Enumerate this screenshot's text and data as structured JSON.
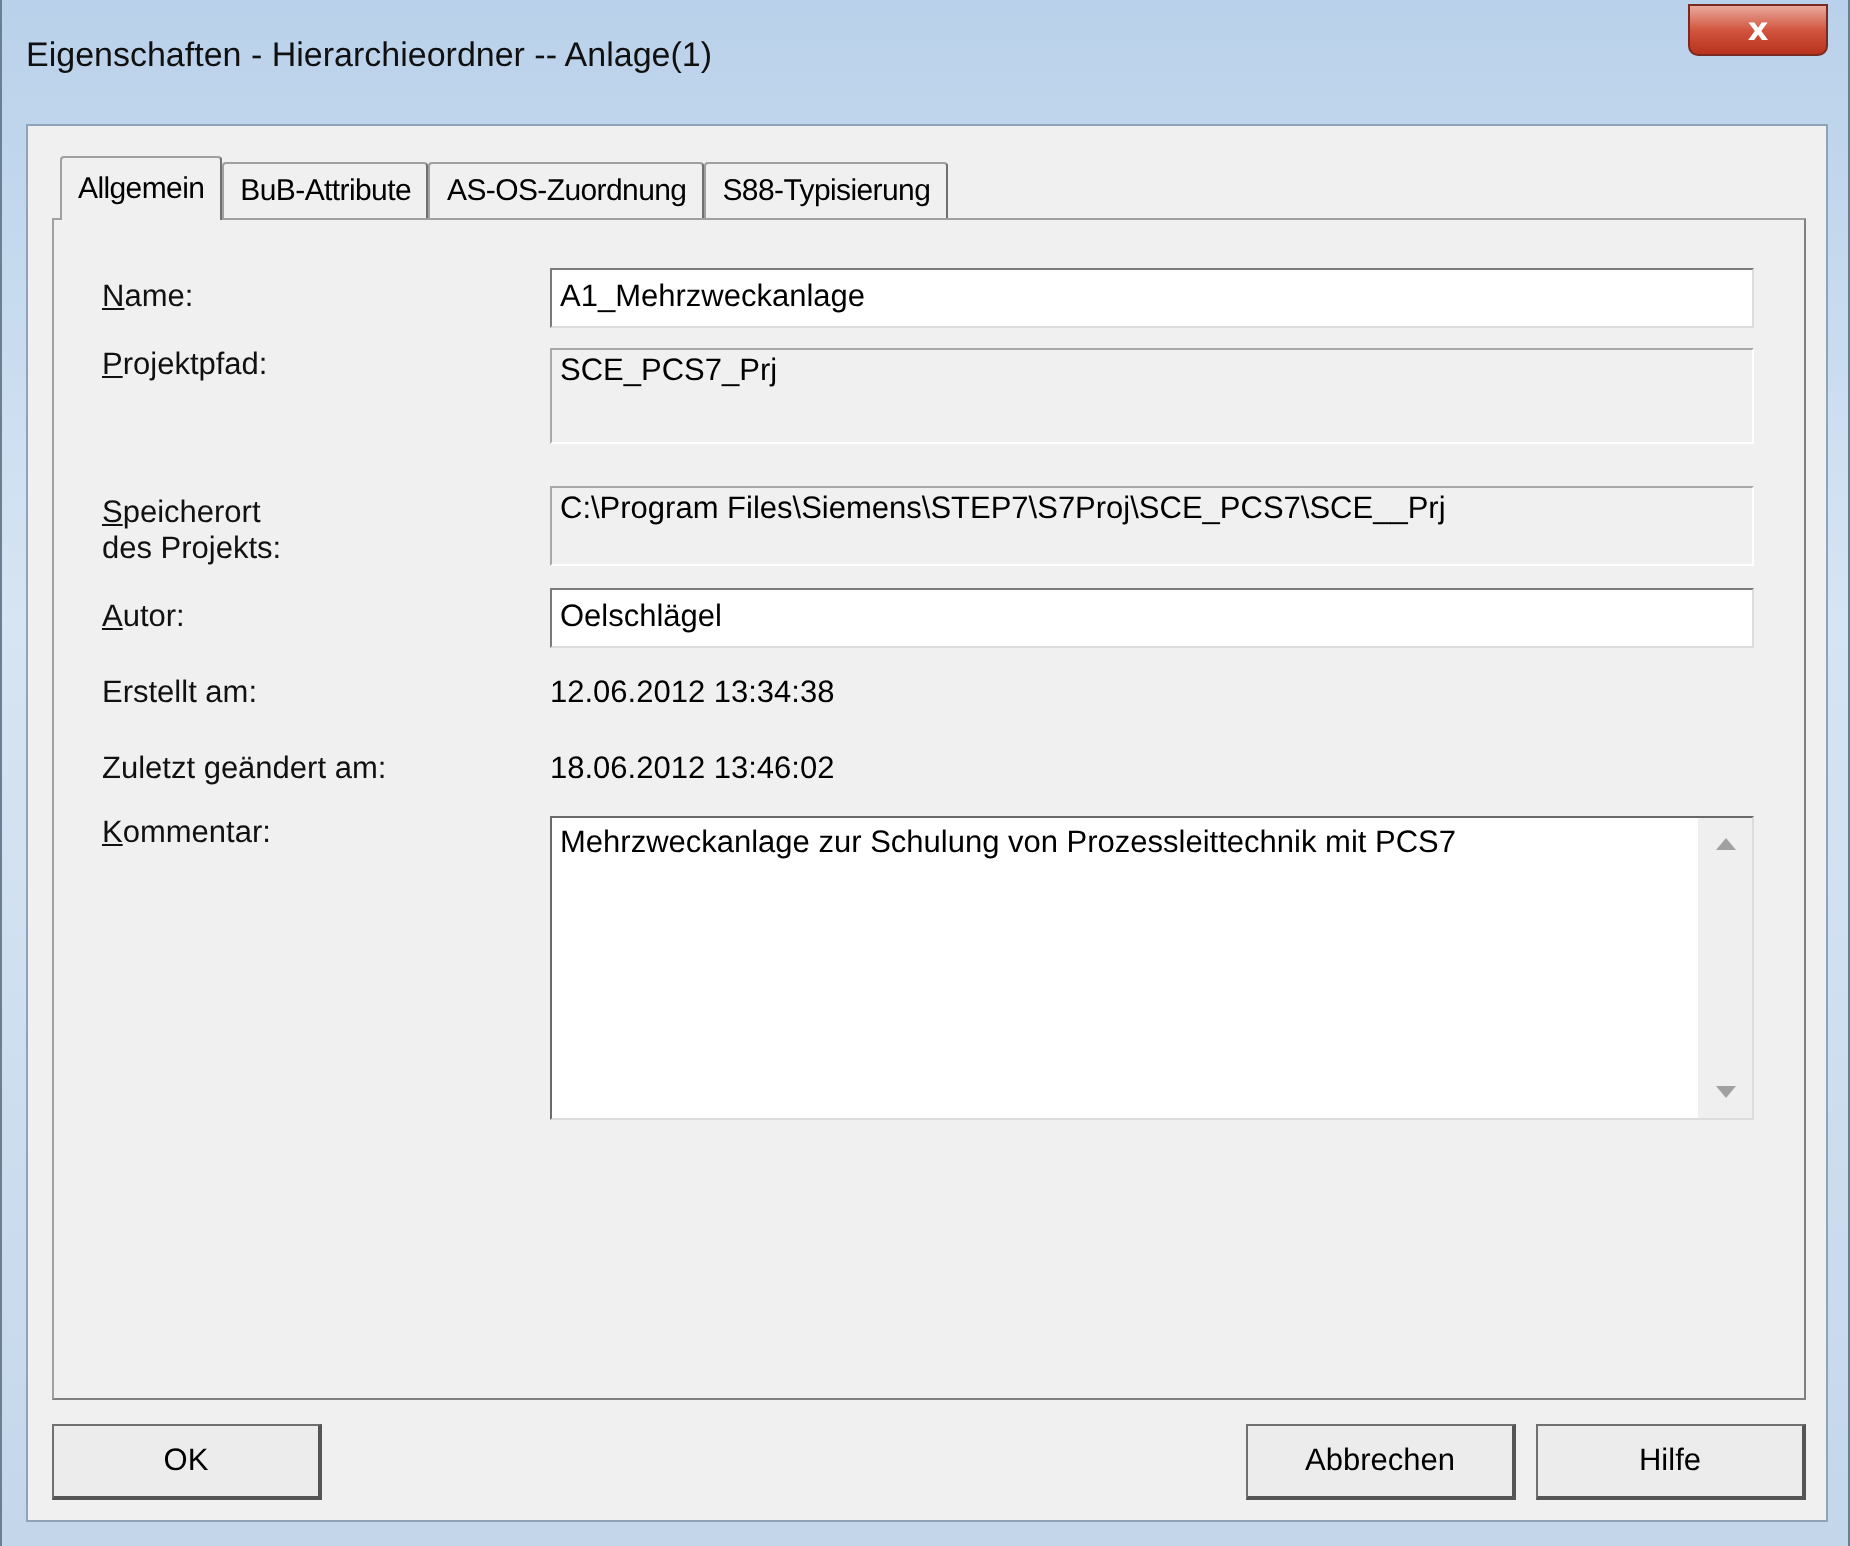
{
  "window": {
    "title": "Eigenschaften - Hierarchieordner -- Anlage(1)",
    "close": "x"
  },
  "tabs": [
    {
      "label": "Allgemein",
      "selected": true
    },
    {
      "label": "BuB-Attribute",
      "selected": false
    },
    {
      "label": "AS-OS-Zuordnung",
      "selected": false
    },
    {
      "label": "S88-Typisierung",
      "selected": false
    }
  ],
  "fields": [
    {
      "kind": "input",
      "label": "Name:",
      "mnemonic": true,
      "value": "A1_Mehrzweckanlage"
    },
    {
      "kind": "readonly",
      "label": "Projektpfad:",
      "mnemonic": true,
      "value": "SCE_PCS7_Prj"
    },
    {
      "kind": "readonly-short",
      "label": "Speicherort\ndes Projekts:",
      "mnemonic": true,
      "value": "C:\\Program Files\\Siemens\\STEP7\\S7Proj\\SCE_PCS7\\SCE__Prj"
    },
    {
      "kind": "input",
      "label": "Autor:",
      "mnemonic": true,
      "value": "Oelschlägel"
    },
    {
      "kind": "text",
      "label": "Erstellt am:",
      "mnemonic": false,
      "value": "12.06.2012 13:34:38"
    },
    {
      "kind": "text",
      "label": "Zuletzt geändert am:",
      "mnemonic": false,
      "value": "18.06.2012 13:46:02"
    },
    {
      "kind": "textarea",
      "label": "Kommentar:",
      "mnemonic": true,
      "value": "Mehrzweckanlage zur Schulung von Prozessleittechnik mit PCS7"
    }
  ],
  "buttons": [
    {
      "label": "OK"
    },
    {
      "label": "Abbrechen"
    },
    {
      "label": "Hilfe"
    }
  ]
}
